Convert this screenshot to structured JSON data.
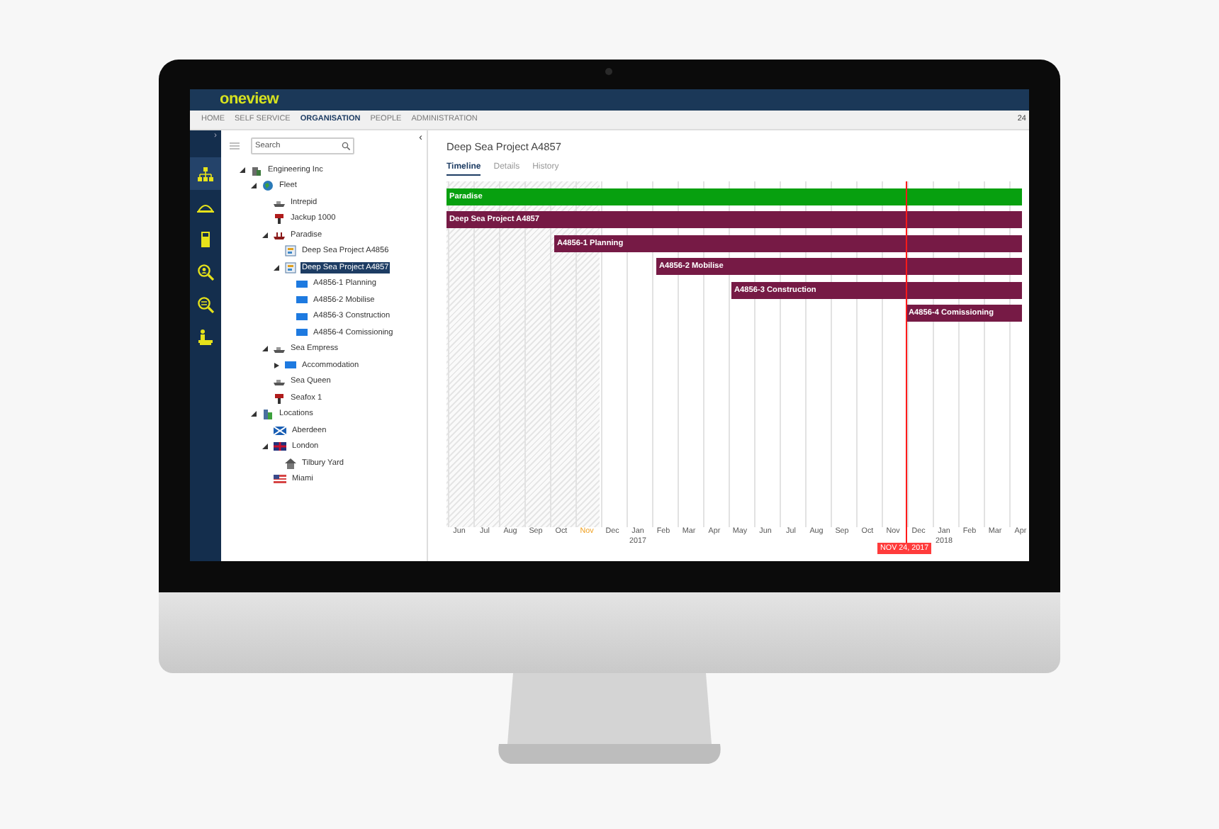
{
  "app": {
    "logo": "oneview"
  },
  "nav": {
    "items": [
      {
        "label": "HOME",
        "selected": false
      },
      {
        "label": "SELF SERVICE",
        "selected": false
      },
      {
        "label": "ORGANISATION",
        "selected": true
      },
      {
        "label": "PEOPLE",
        "selected": false
      },
      {
        "label": "ADMINISTRATION",
        "selected": false
      }
    ],
    "right_text": "24"
  },
  "rail": {
    "toggle": "›",
    "items": [
      {
        "kind": "org",
        "selected": true
      },
      {
        "kind": "dome",
        "selected": false
      },
      {
        "kind": "calculator",
        "selected": false
      },
      {
        "kind": "search-person",
        "selected": false
      },
      {
        "kind": "search-list",
        "selected": false
      },
      {
        "kind": "desk",
        "selected": false
      }
    ]
  },
  "tree_panel": {
    "search": {
      "placeholder": "Search"
    },
    "collapse": "‹",
    "tree": [
      {
        "label": "Engineering Inc",
        "kind": "company",
        "expanded": true,
        "selected": false,
        "children": [
          {
            "label": "Fleet",
            "kind": "globe",
            "expanded": true,
            "selected": false,
            "children": [
              {
                "label": "Intrepid",
                "kind": "vessel",
                "selected": false
              },
              {
                "label": "Jackup 1000",
                "kind": "rig",
                "selected": false
              },
              {
                "label": "Paradise",
                "kind": "ship",
                "expanded": true,
                "selected": false,
                "children": [
                  {
                    "label": "Deep Sea Project A4856",
                    "kind": "project",
                    "selected": false
                  },
                  {
                    "label": "Deep Sea Project A4857",
                    "kind": "project",
                    "expanded": true,
                    "selected": true,
                    "children": [
                      {
                        "label": "A4856-1 Planning",
                        "kind": "task",
                        "selected": false
                      },
                      {
                        "label": "A4856-2 Mobilise",
                        "kind": "task",
                        "selected": false
                      },
                      {
                        "label": "A4856-3 Construction",
                        "kind": "task",
                        "selected": false
                      },
                      {
                        "label": "A4856-4 Comissioning",
                        "kind": "task",
                        "selected": false
                      }
                    ]
                  }
                ]
              },
              {
                "label": "Sea Empress",
                "kind": "vessel",
                "expanded": true,
                "selected": false,
                "children": [
                  {
                    "label": "Accommodation",
                    "kind": "task",
                    "expanded": false,
                    "selected": false
                  }
                ]
              },
              {
                "label": "Sea Queen",
                "kind": "vessel",
                "selected": false
              },
              {
                "label": "Seafox 1",
                "kind": "rig",
                "selected": false
              }
            ]
          },
          {
            "label": "Locations",
            "kind": "locations",
            "expanded": true,
            "selected": false,
            "children": [
              {
                "label": "Aberdeen",
                "kind": "flag-sco",
                "selected": false
              },
              {
                "label": "London",
                "kind": "flag-uk",
                "expanded": true,
                "selected": false,
                "children": [
                  {
                    "label": "Tilbury Yard",
                    "kind": "site",
                    "selected": false
                  }
                ]
              },
              {
                "label": "Miami",
                "kind": "flag-us",
                "selected": false
              }
            ]
          }
        ]
      }
    ]
  },
  "detail": {
    "title": "Deep Sea Project A4857",
    "tabs": [
      {
        "label": "Timeline",
        "selected": true
      },
      {
        "label": "Details",
        "selected": false
      },
      {
        "label": "History",
        "selected": false
      }
    ],
    "timeline": {
      "bars": [
        {
          "label": "Paradise",
          "kind": "vessel"
        },
        {
          "label": "Deep Sea Project A4857",
          "kind": "project"
        },
        {
          "label": "A4856-1 Planning",
          "kind": "task"
        },
        {
          "label": "A4856-2 Mobilise",
          "kind": "task"
        },
        {
          "label": "A4856-3 Construction",
          "kind": "task"
        },
        {
          "label": "A4856-4 Comissioning",
          "kind": "task"
        }
      ],
      "months": [
        {
          "label": "Jun",
          "highlight": false
        },
        {
          "label": "Jul",
          "highlight": false
        },
        {
          "label": "Aug",
          "highlight": false
        },
        {
          "label": "Sep",
          "highlight": false
        },
        {
          "label": "Oct",
          "highlight": false
        },
        {
          "label": "Nov",
          "highlight": true
        },
        {
          "label": "Dec",
          "highlight": false
        },
        {
          "label": "Jan",
          "year": "2017",
          "highlight": false
        },
        {
          "label": "Feb",
          "highlight": false
        },
        {
          "label": "Mar",
          "highlight": false
        },
        {
          "label": "Apr",
          "highlight": false
        },
        {
          "label": "May",
          "highlight": false
        },
        {
          "label": "Jun",
          "highlight": false
        },
        {
          "label": "Jul",
          "highlight": false
        },
        {
          "label": "Aug",
          "highlight": false
        },
        {
          "label": "Sep",
          "highlight": false
        },
        {
          "label": "Oct",
          "highlight": false
        },
        {
          "label": "Nov",
          "highlight": false
        },
        {
          "label": "Dec",
          "highlight": false
        },
        {
          "label": "Jan",
          "year": "2018",
          "highlight": false
        },
        {
          "label": "Feb",
          "highlight": false
        },
        {
          "label": "Mar",
          "highlight": false
        },
        {
          "label": "Apr",
          "highlight": false
        }
      ],
      "today": "NOV 24, 2017"
    }
  }
}
